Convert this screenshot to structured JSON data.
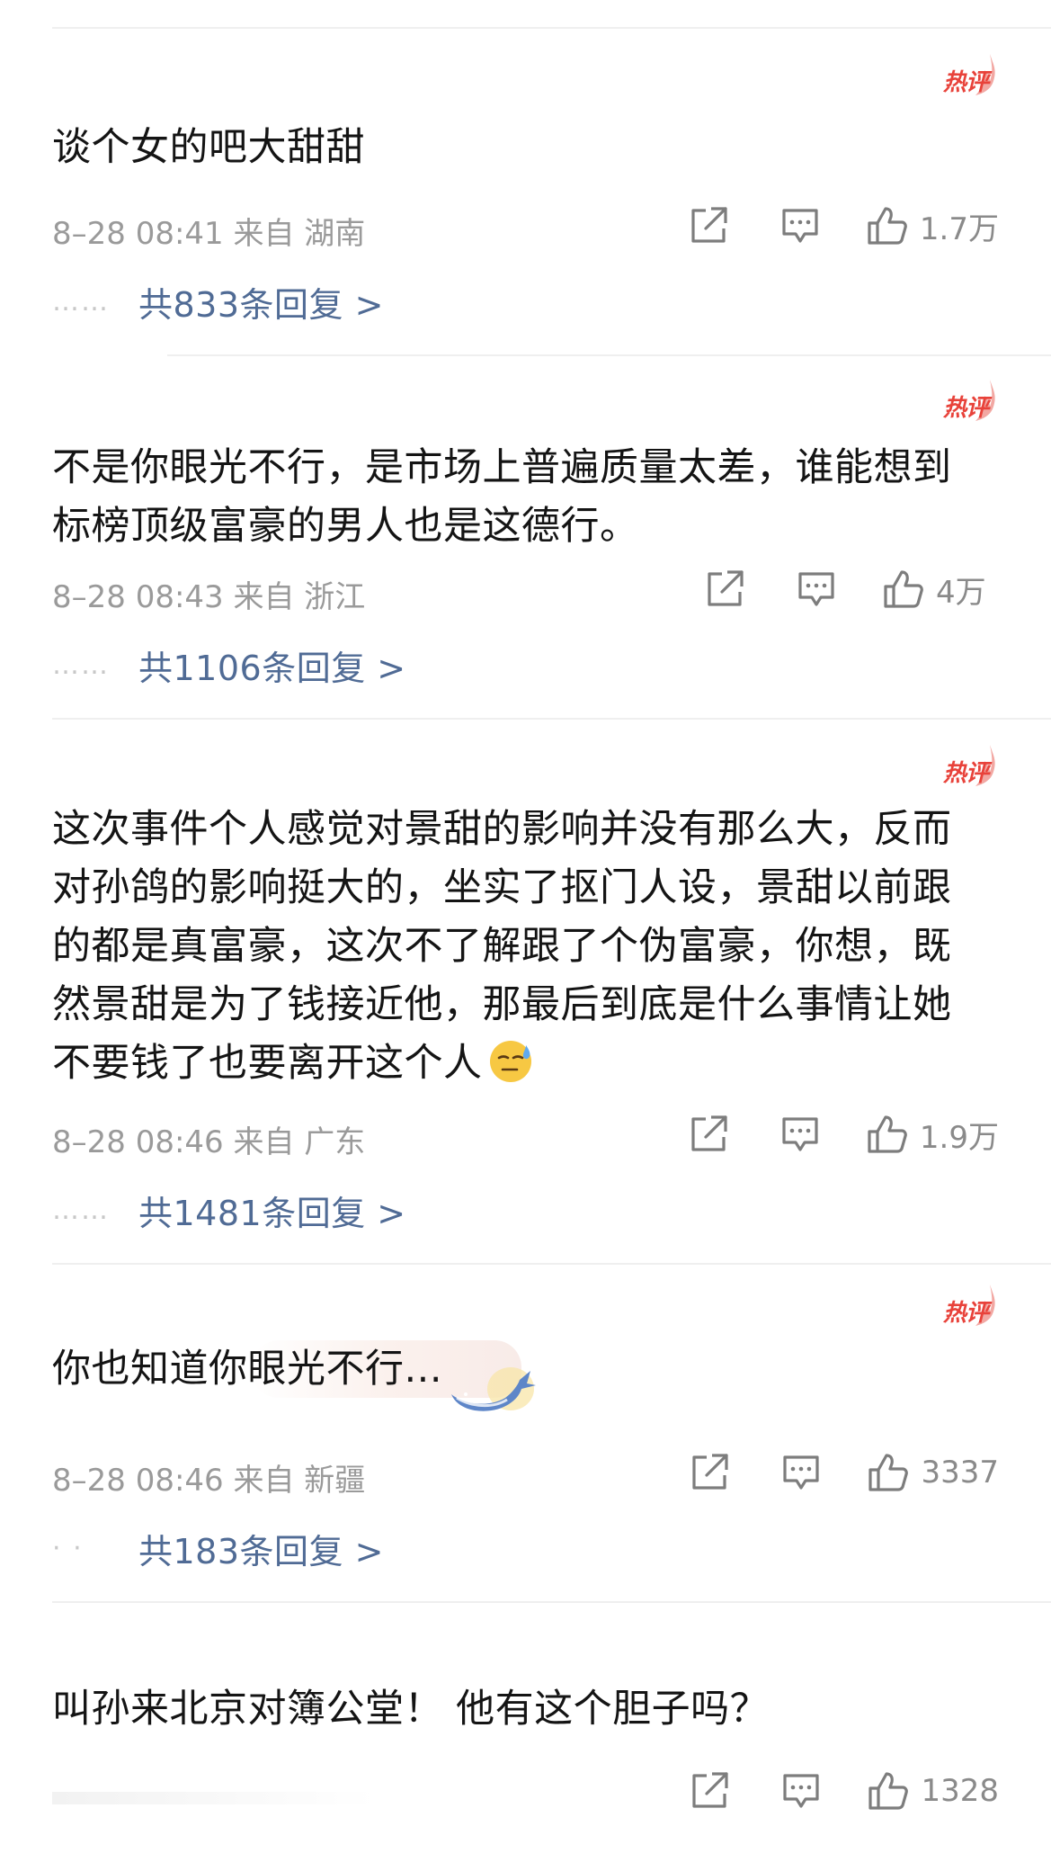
{
  "badge_label": "热评",
  "comments": [
    {
      "text_lines": [
        "谈个女的吧大甜甜"
      ],
      "meta": "8–28 08:41  来自 湖南",
      "likes": "1.7万",
      "reply_dots": "……",
      "reply_label": "共833条回复 >"
    },
    {
      "text_lines": [
        "不是你眼光不行，是市场上普遍质量太差，谁能想到",
        "标榜顶级富豪的男人也是这德行。"
      ],
      "meta": "8–28 08:43  来自 浙江",
      "likes": "4万",
      "reply_dots": "……",
      "reply_label": "共1106条回复 >"
    },
    {
      "text_lines": [
        " 这次事件个人感觉对景甜的影响并没有那么大，反而",
        "对孙鸽的影响挺大的，坐实了抠门人设，景甜以前跟",
        "的都是真富豪，这次不了解跟了个伪富豪，你想，既",
        "然景甜是为了钱接近他，那最后到底是什么事情让她",
        "不要钱了也要离开这个人"
      ],
      "emoji": "sweat-smile-emoji",
      "meta": "8–28 08:46  来自 广东",
      "likes": "1.9万",
      "reply_dots": "……",
      "reply_label": "共1481条回复 >"
    },
    {
      "text_lines": [
        "你也知道你眼光不行..."
      ],
      "meta": "8–28 08:46  来自 新疆",
      "likes": "3337",
      "reply_dots": "· ·",
      "reply_label": "共183条回复 >"
    },
    {
      "text_lines": [
        "叫孙来北京对簿公堂！ 他有这个胆子吗？"
      ],
      "meta": "",
      "likes": "1328"
    }
  ],
  "colors": {
    "hot": "#e8423a",
    "reply_link": "#506b95",
    "meta": "#9a9a9a",
    "divider": "#efefef"
  },
  "icons": [
    "share-icon",
    "comment-icon",
    "thumbs-up-icon"
  ]
}
